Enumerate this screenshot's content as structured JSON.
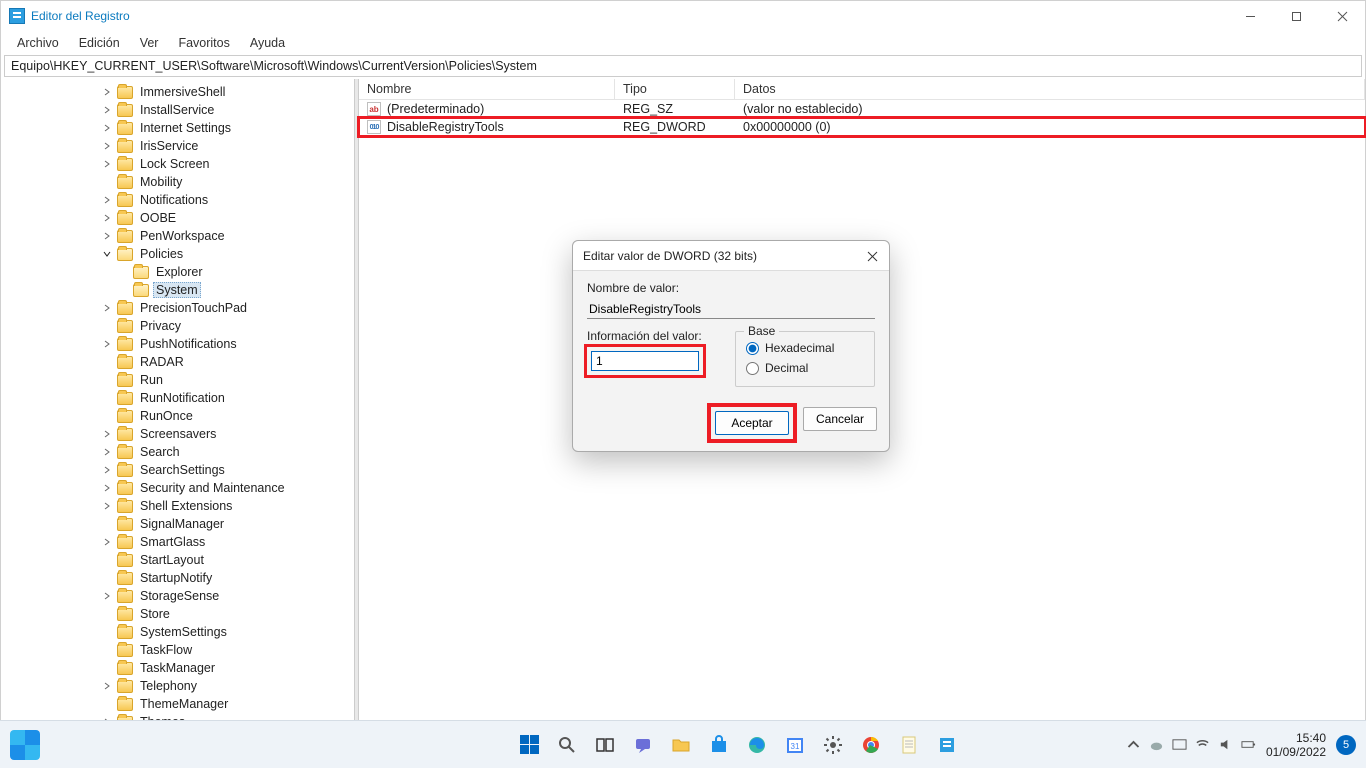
{
  "window": {
    "title": "Editor del Registro"
  },
  "menu": {
    "items": [
      "Archivo",
      "Edición",
      "Ver",
      "Favoritos",
      "Ayuda"
    ]
  },
  "addressbar": {
    "path": "Equipo\\HKEY_CURRENT_USER\\Software\\Microsoft\\Windows\\CurrentVersion\\Policies\\System"
  },
  "tree": {
    "items": [
      {
        "label": "ImmersiveShell",
        "chevron": "right",
        "depth": 0
      },
      {
        "label": "InstallService",
        "chevron": "right",
        "depth": 0
      },
      {
        "label": "Internet Settings",
        "chevron": "right",
        "depth": 0
      },
      {
        "label": "IrisService",
        "chevron": "right",
        "depth": 0
      },
      {
        "label": "Lock Screen",
        "chevron": "right",
        "depth": 0
      },
      {
        "label": "Mobility",
        "chevron": "none",
        "depth": 0
      },
      {
        "label": "Notifications",
        "chevron": "right",
        "depth": 0
      },
      {
        "label": "OOBE",
        "chevron": "right",
        "depth": 0
      },
      {
        "label": "PenWorkspace",
        "chevron": "right",
        "depth": 0
      },
      {
        "label": "Policies",
        "chevron": "down",
        "depth": 0,
        "open": true
      },
      {
        "label": "Explorer",
        "chevron": "none",
        "depth": 1,
        "open": true
      },
      {
        "label": "System",
        "chevron": "none",
        "depth": 1,
        "open": true,
        "selected": true
      },
      {
        "label": "PrecisionTouchPad",
        "chevron": "right",
        "depth": 0
      },
      {
        "label": "Privacy",
        "chevron": "none",
        "depth": 0
      },
      {
        "label": "PushNotifications",
        "chevron": "right",
        "depth": 0
      },
      {
        "label": "RADAR",
        "chevron": "none",
        "depth": 0
      },
      {
        "label": "Run",
        "chevron": "none",
        "depth": 0
      },
      {
        "label": "RunNotification",
        "chevron": "none",
        "depth": 0
      },
      {
        "label": "RunOnce",
        "chevron": "none",
        "depth": 0
      },
      {
        "label": "Screensavers",
        "chevron": "right",
        "depth": 0
      },
      {
        "label": "Search",
        "chevron": "right",
        "depth": 0
      },
      {
        "label": "SearchSettings",
        "chevron": "right",
        "depth": 0
      },
      {
        "label": "Security and Maintenance",
        "chevron": "right",
        "depth": 0
      },
      {
        "label": "Shell Extensions",
        "chevron": "right",
        "depth": 0
      },
      {
        "label": "SignalManager",
        "chevron": "none",
        "depth": 0
      },
      {
        "label": "SmartGlass",
        "chevron": "right",
        "depth": 0
      },
      {
        "label": "StartLayout",
        "chevron": "none",
        "depth": 0
      },
      {
        "label": "StartupNotify",
        "chevron": "none",
        "depth": 0
      },
      {
        "label": "StorageSense",
        "chevron": "right",
        "depth": 0
      },
      {
        "label": "Store",
        "chevron": "none",
        "depth": 0
      },
      {
        "label": "SystemSettings",
        "chevron": "none",
        "depth": 0
      },
      {
        "label": "TaskFlow",
        "chevron": "none",
        "depth": 0
      },
      {
        "label": "TaskManager",
        "chevron": "none",
        "depth": 0
      },
      {
        "label": "Telephony",
        "chevron": "right",
        "depth": 0
      },
      {
        "label": "ThemeManager",
        "chevron": "none",
        "depth": 0
      },
      {
        "label": "Themes",
        "chevron": "right",
        "depth": 0
      }
    ]
  },
  "list": {
    "columns": {
      "name": "Nombre",
      "type": "Tipo",
      "data": "Datos"
    },
    "rows": [
      {
        "icon": "ab",
        "name": "(Predeterminado)",
        "type": "REG_SZ",
        "data": "(valor no establecido)",
        "highlight": false
      },
      {
        "icon": "num",
        "name": "DisableRegistryTools",
        "type": "REG_DWORD",
        "data": "0x00000000 (0)",
        "highlight": true
      }
    ]
  },
  "dialog": {
    "title": "Editar valor de DWORD (32 bits)",
    "value_name_label": "Nombre de valor:",
    "value_name": "DisableRegistryTools",
    "value_data_label": "Información del valor:",
    "value_data": "1",
    "base_label": "Base",
    "hex_label": "Hexadecimal",
    "dec_label": "Decimal",
    "base_selected": "hex",
    "accept": "Aceptar",
    "cancel": "Cancelar"
  },
  "taskbar": {
    "time": "15:40",
    "date": "01/09/2022",
    "user_initial": "5"
  }
}
